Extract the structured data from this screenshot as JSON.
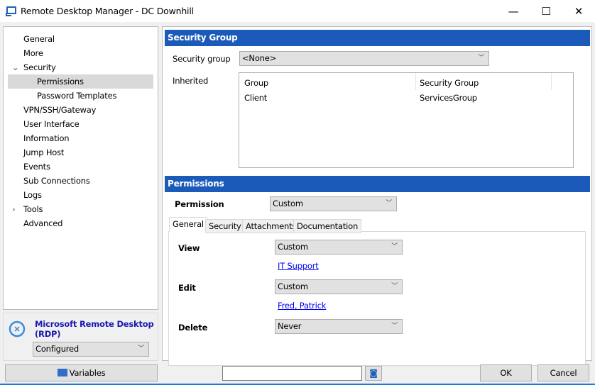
{
  "window": {
    "title": "Remote Desktop Manager - DC Downhill",
    "minimize": "—",
    "maximize": "☐",
    "close": "✕"
  },
  "tree": [
    {
      "label": "General"
    },
    {
      "label": "More"
    },
    {
      "label": "Security",
      "expander": "⌄"
    },
    {
      "label": "Permissions",
      "selected": true
    },
    {
      "label": "Password Templates"
    },
    {
      "label": "VPN/SSH/Gateway"
    },
    {
      "label": "User Interface"
    },
    {
      "label": "Information"
    },
    {
      "label": "Jump Host"
    },
    {
      "label": "Events"
    },
    {
      "label": "Sub Connections"
    },
    {
      "label": "Logs"
    },
    {
      "label": "Tools",
      "expander": "›"
    },
    {
      "label": "Advanced"
    }
  ],
  "connection": {
    "name": "Microsoft Remote Desktop (RDP)",
    "status": "Configured"
  },
  "security_group": {
    "header": "Security Group",
    "label": "Security group",
    "value": "<None>",
    "inherited_label": "Inherited",
    "columns": [
      "Group",
      "Security Group"
    ],
    "rows": [
      [
        "Client",
        "ServicesGroup"
      ]
    ]
  },
  "permissions": {
    "header": "Permissions",
    "label": "Permission",
    "value": "Custom",
    "tabs": [
      "General",
      "Security",
      "Attachments",
      "Documentation"
    ],
    "view": {
      "label": "View",
      "value": "Custom",
      "link": "IT Support"
    },
    "edit": {
      "label": "Edit",
      "value": "Custom",
      "link": "Fred, Patrick"
    },
    "delete": {
      "label": "Delete",
      "value": "Never"
    }
  },
  "footer": {
    "variables": "Variables",
    "search_value": "",
    "ok": "OK",
    "cancel": "Cancel"
  },
  "colors": {
    "accent": "#1b5ab8",
    "link": "#0000ee"
  }
}
